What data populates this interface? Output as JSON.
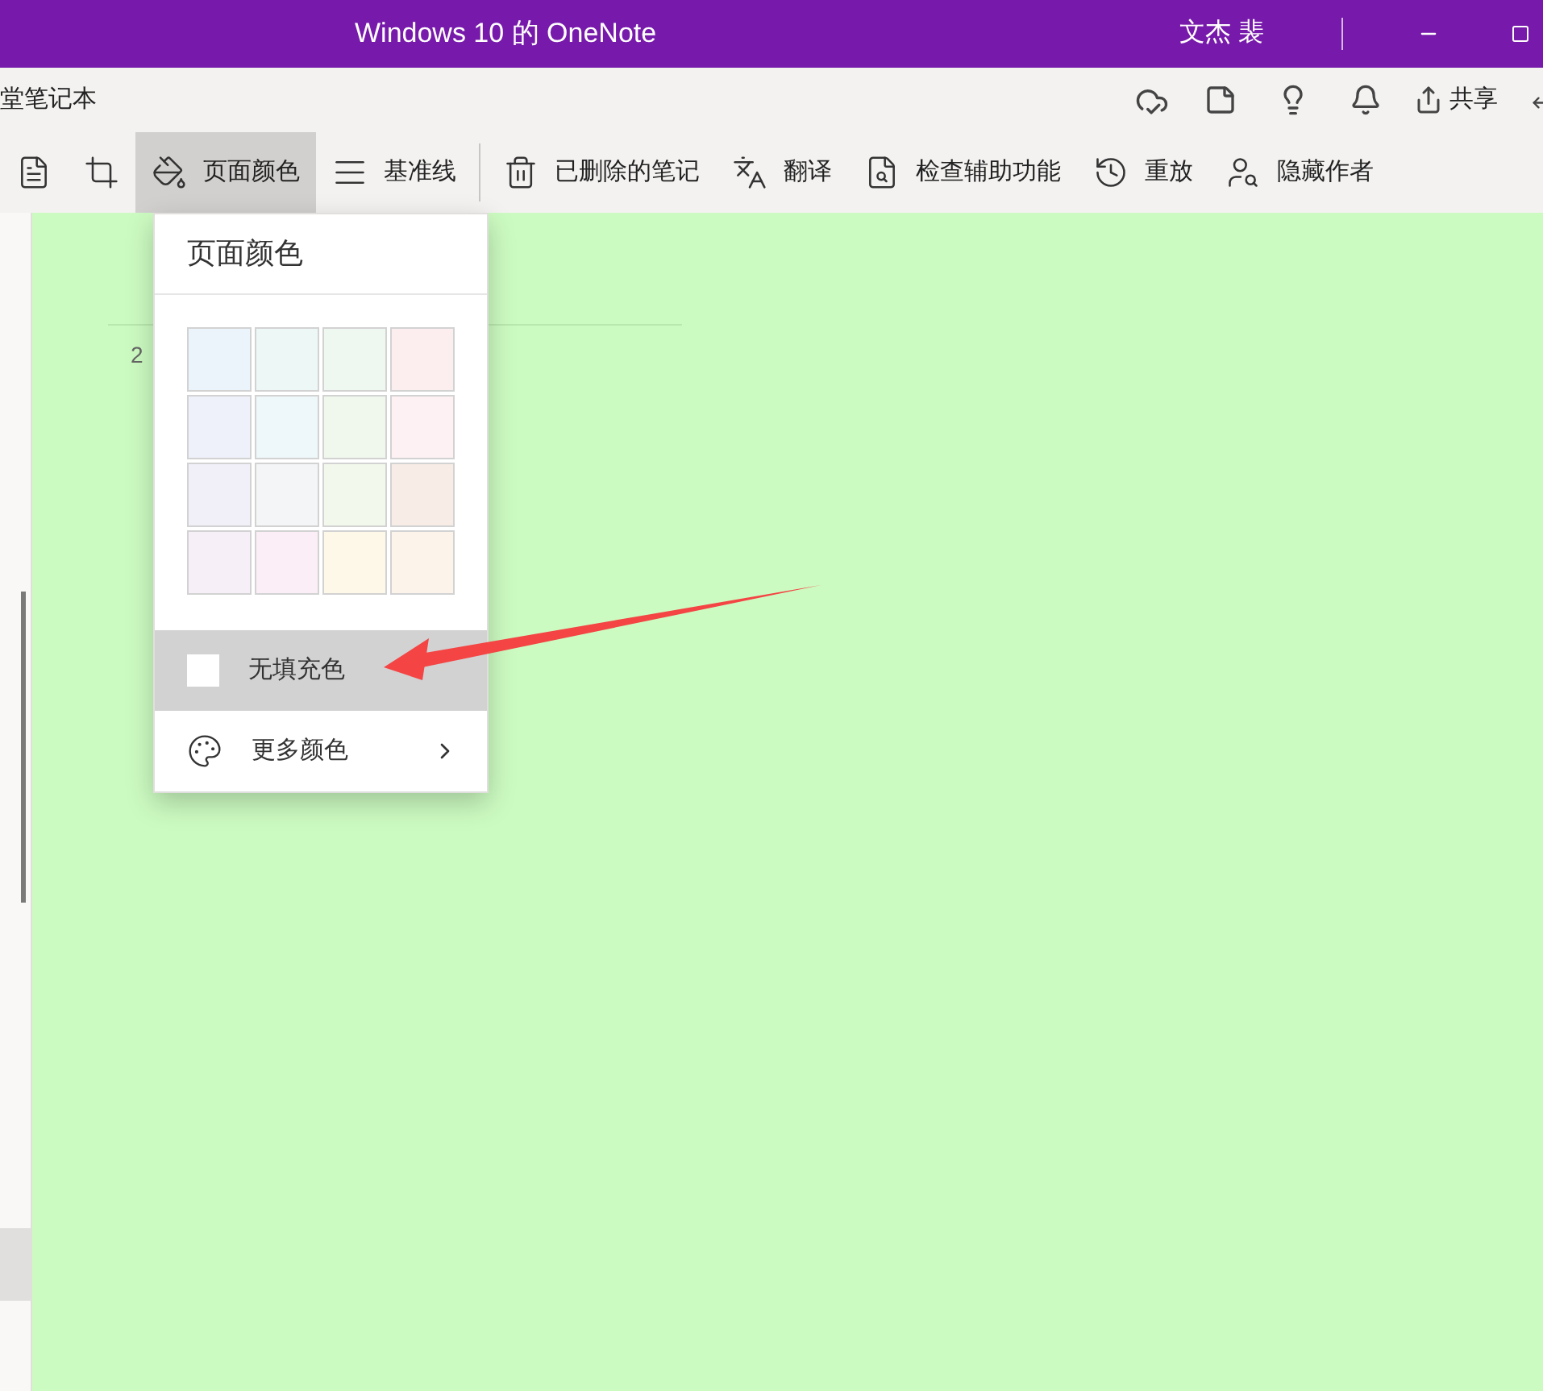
{
  "window": {
    "title": "Windows 10 的 OneNote",
    "user": "文杰 裴"
  },
  "notebook": {
    "name": "堂笔记本",
    "share": "共享"
  },
  "toolbar": [
    {
      "kind": "page-size",
      "selected": false
    },
    {
      "kind": "margins",
      "selected": false
    },
    {
      "kind": "page-color",
      "label": "页面颜色",
      "selected": true
    },
    {
      "kind": "rule-lines",
      "label": "基准线",
      "selected": false
    },
    {
      "kind": "deleted",
      "label": "已删除的笔记",
      "selected": false
    },
    {
      "kind": "translate",
      "label": "翻译",
      "selected": false
    },
    {
      "kind": "accessibility",
      "label": "检查辅助功能",
      "selected": false
    },
    {
      "kind": "replay",
      "label": "重放",
      "selected": false
    },
    {
      "kind": "hide-authors",
      "label": "隐藏作者",
      "selected": false
    }
  ],
  "page": {
    "date": "2"
  },
  "color_menu": {
    "title": "页面颜色",
    "swatches": [
      {
        "color": "#ebf3fb"
      },
      {
        "color": "#edf7f5"
      },
      {
        "color": "#eef8f0"
      },
      {
        "color": "#fcedee"
      },
      {
        "color": "#eef1fa"
      },
      {
        "color": "#eef7f9"
      },
      {
        "color": "#f0f8ee"
      },
      {
        "color": "#fdf1f3"
      },
      {
        "color": "#f1f0f9"
      },
      {
        "color": "#f4f5f6"
      },
      {
        "color": "#f3f8ec"
      },
      {
        "color": "#f7ece6"
      },
      {
        "color": "#f6eff7"
      },
      {
        "color": "#fbeef7"
      },
      {
        "color": "#fef8e8"
      },
      {
        "color": "#fcf3ea"
      }
    ],
    "items": [
      {
        "kind": "no-fill",
        "label": "无填充色",
        "selected": true
      },
      {
        "kind": "more",
        "label": "更多颜色",
        "selected": false
      }
    ]
  }
}
